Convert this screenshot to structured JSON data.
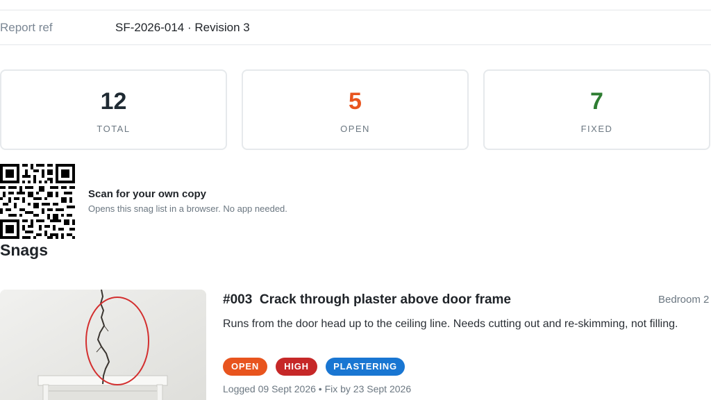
{
  "report": {
    "label": "Report ref",
    "value": "SF-2026-014 · Revision 3"
  },
  "stats": [
    {
      "value": "12",
      "label": "TOTAL",
      "color": "#1f2a33"
    },
    {
      "value": "5",
      "label": "OPEN",
      "color": "#e8541e"
    },
    {
      "value": "7",
      "label": "FIXED",
      "color": "#2e7d32"
    }
  ],
  "qr": {
    "title": "Scan for your own copy",
    "subtitle": "Opens this snag list in a browser. No app needed."
  },
  "snags_heading": "Snags",
  "snag": {
    "number": "#003",
    "title": "Crack through plaster above door frame",
    "location": "Bedroom 2",
    "description": "Runs from the door head up to the ceiling line. Needs cutting out and re-skimming, not filling.",
    "tags": [
      {
        "label": "OPEN",
        "color": "#e8541e"
      },
      {
        "label": "HIGH",
        "color": "#c62828"
      },
      {
        "label": "PLASTERING",
        "color": "#1976d2"
      }
    ],
    "meta": "Logged 09 Sept 2026 • Fix by 23 Sept 2026"
  }
}
